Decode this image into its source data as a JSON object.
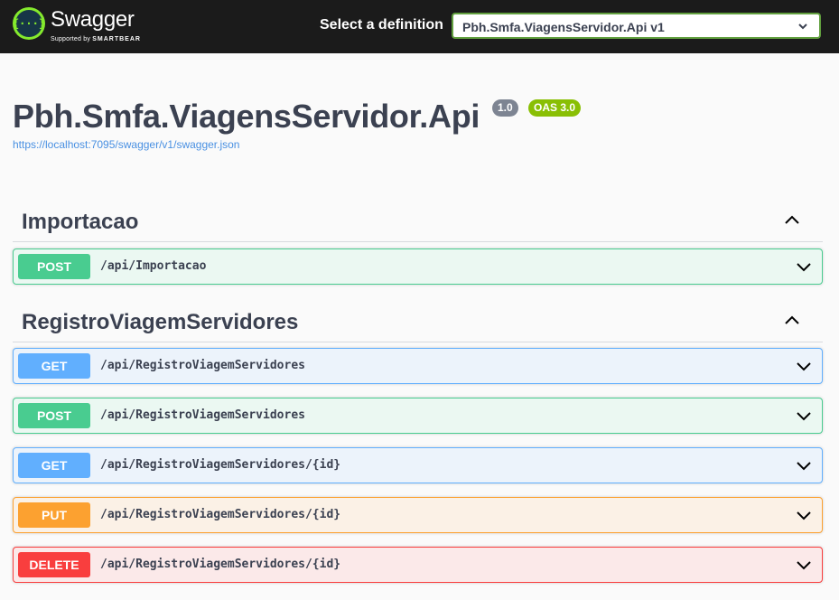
{
  "topbar": {
    "brand": "Swagger",
    "supported_by": "Supported by",
    "smartbear": "SMARTBEAR",
    "logo_glyph": "{···}",
    "definition_label": "Select a definition",
    "definition_selected": "Pbh.Smfa.ViagensServidor.Api v1"
  },
  "info": {
    "title": "Pbh.Smfa.ViagensServidor.Api",
    "version": "1.0",
    "oas": "OAS 3.0",
    "spec_url": "https://localhost:7095/swagger/v1/swagger.json"
  },
  "tags": [
    {
      "name": "Importacao",
      "operations": [
        {
          "method": "POST",
          "path": "/api/Importacao"
        }
      ]
    },
    {
      "name": "RegistroViagemServidores",
      "operations": [
        {
          "method": "GET",
          "path": "/api/RegistroViagemServidores"
        },
        {
          "method": "POST",
          "path": "/api/RegistroViagemServidores"
        },
        {
          "method": "GET",
          "path": "/api/RegistroViagemServidores/{id}"
        },
        {
          "method": "PUT",
          "path": "/api/RegistroViagemServidores/{id}"
        },
        {
          "method": "DELETE",
          "path": "/api/RegistroViagemServidores/{id}"
        }
      ]
    }
  ],
  "colors": {
    "post": "#49cc90",
    "get": "#61affe",
    "put": "#fca130",
    "delete": "#f93e3e",
    "swagger_green": "#85ea2d",
    "topbar": "#1b1b1b"
  }
}
